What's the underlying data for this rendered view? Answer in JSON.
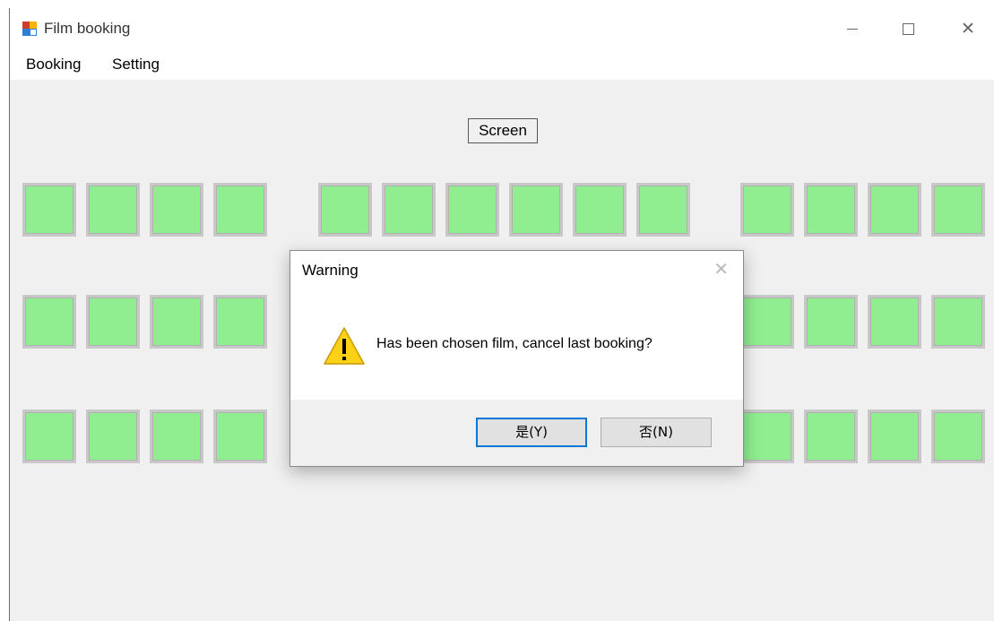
{
  "window": {
    "title": "Film booking",
    "app_icon": "windows-forms-app-icon",
    "controls": {
      "minimize_icon": "minimize-icon",
      "maximize_icon": "maximize-icon",
      "close_icon": "close-icon"
    }
  },
  "menu": {
    "items": [
      {
        "label": "Booking"
      },
      {
        "label": "Setting"
      }
    ]
  },
  "screen_label": "Screen",
  "seating": {
    "rows": 3,
    "blocks": [
      4,
      6,
      4
    ],
    "seat_color": "#90ee90",
    "seat_border_color": "#c8c8c8"
  },
  "dialog": {
    "title": "Warning",
    "icon": "warning-icon",
    "message": "Has been chosen film, cancel last booking?",
    "buttons": {
      "yes": "是(Y)",
      "no": "否(N)"
    }
  }
}
